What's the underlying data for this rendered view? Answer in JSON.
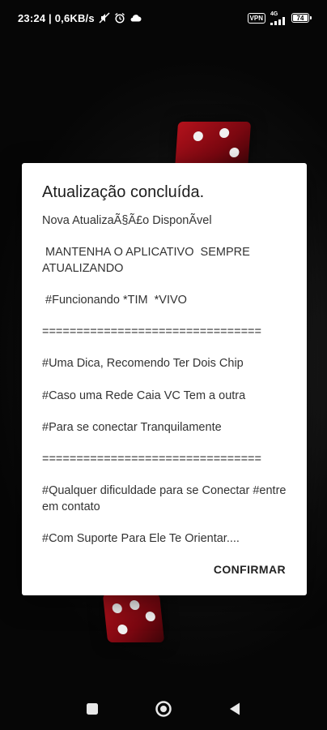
{
  "status_bar": {
    "time_info": "23:24 | 0,6KB/s",
    "vpn": "VPN",
    "network": "4G",
    "battery": "74"
  },
  "dialog": {
    "title": "Atualização concluída.",
    "body": "Nova AtualizaÃ§Ã£o DisponÃvel\n\n MANTENHA O APLICATIVO  SEMPRE ATUALIZANDO\n\n #Funcionando *TIM  *VIVO\n\n================================\n\n#Uma Dica, Recomendo Ter Dois Chip\n\n#Caso uma Rede Caia VC Tem a outra\n\n#Para se conectar Tranquilamente\n\n================================\n\n#Qualquer dificuldade para se Conectar #entre em contato\n\n#Com Suporte Para Ele Te Orientar....",
    "confirm_label": "CONFIRMAR"
  },
  "nav_bar": {
    "icons": [
      "recents-icon",
      "home-icon",
      "back-icon"
    ]
  }
}
